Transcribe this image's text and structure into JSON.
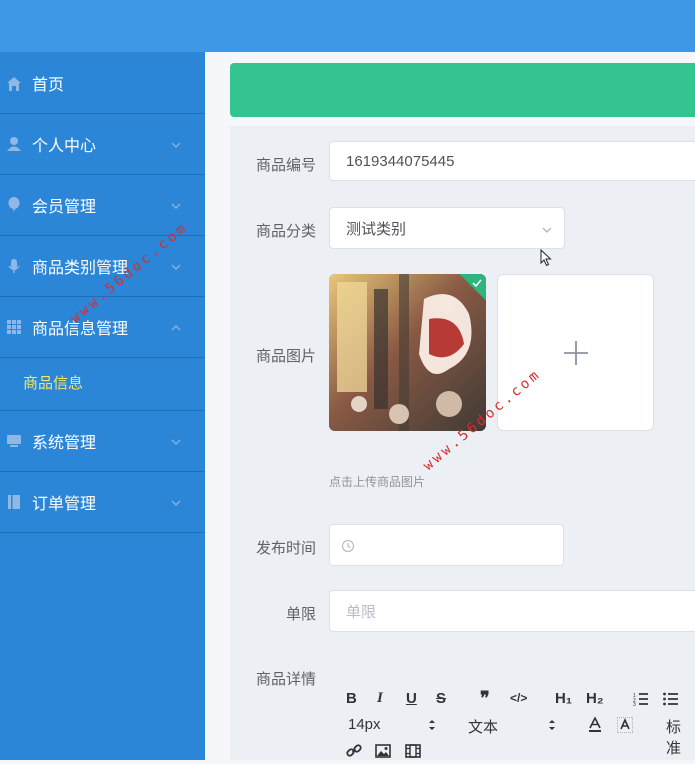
{
  "sidebar": {
    "items": [
      {
        "label": "首页",
        "icon": "home-icon",
        "has_chevron": false
      },
      {
        "label": "个人中心",
        "icon": "user-icon",
        "has_chevron": true
      },
      {
        "label": "会员管理",
        "icon": "balloon-icon",
        "has_chevron": true
      },
      {
        "label": "商品类别管理",
        "icon": "microphone-icon",
        "has_chevron": true
      },
      {
        "label": "商品信息管理",
        "icon": "grid-icon",
        "has_chevron": true,
        "expanded": true
      },
      {
        "label": "系统管理",
        "icon": "monitor-icon",
        "has_chevron": true
      },
      {
        "label": "订单管理",
        "icon": "book-icon",
        "has_chevron": true
      }
    ],
    "sub_item": "商品信息"
  },
  "form": {
    "product_no": {
      "label": "商品编号",
      "value": "1619344075445"
    },
    "category": {
      "label": "商品分类",
      "value": "测试类别"
    },
    "image": {
      "label": "商品图片",
      "hint": "点击上传商品图片"
    },
    "publish_time": {
      "label": "发布时间",
      "value": ""
    },
    "limit": {
      "label": "单限",
      "placeholder": "单限"
    },
    "details": {
      "label": "商品详情"
    }
  },
  "editor": {
    "bold": "B",
    "italic": "I",
    "underline": "U",
    "strike": "S",
    "quote": "❞",
    "code": "</>",
    "h1": "H₁",
    "h2": "H₂",
    "font_size": "14px",
    "text_style": "文本",
    "align": "标准"
  },
  "watermark": "www.56doc.com",
  "colors": {
    "topbar": "#3f98e6",
    "sidebar": "#2c86d8",
    "active_sub": "#f2e66b",
    "banner": "#33c48f",
    "check": "#2fb47e"
  }
}
